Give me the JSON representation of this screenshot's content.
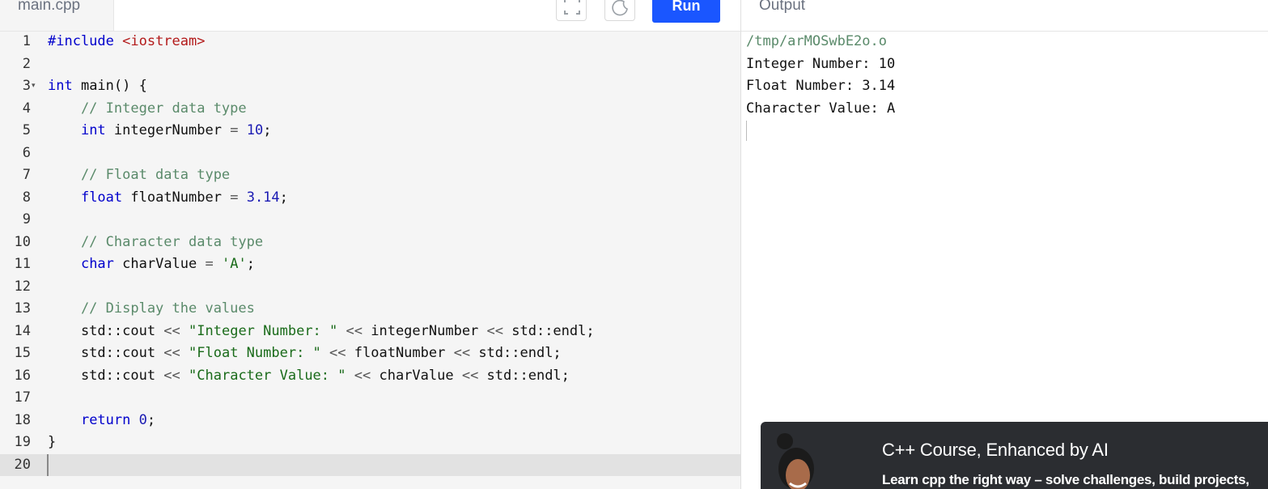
{
  "editor": {
    "file_tab": "main.cpp",
    "run_label": "Run",
    "fullscreen_icon": "fullscreen-icon",
    "theme_icon": "moon-icon",
    "lines": [
      {
        "n": "1",
        "tokens": [
          {
            "t": "#include ",
            "c": "kw"
          },
          {
            "t": "<iostream>",
            "c": "inc"
          }
        ]
      },
      {
        "n": "2",
        "tokens": []
      },
      {
        "n": "3",
        "fold": true,
        "tokens": [
          {
            "t": "int",
            "c": "kw"
          },
          {
            "t": " main() {",
            "c": ""
          }
        ]
      },
      {
        "n": "4",
        "tokens": [
          {
            "t": "    // Integer data type",
            "c": "cmt"
          }
        ]
      },
      {
        "n": "5",
        "tokens": [
          {
            "t": "    ",
            "c": ""
          },
          {
            "t": "int",
            "c": "kw"
          },
          {
            "t": " integerNumber ",
            "c": ""
          },
          {
            "t": "=",
            "c": "op"
          },
          {
            "t": " ",
            "c": ""
          },
          {
            "t": "10",
            "c": "num"
          },
          {
            "t": ";",
            "c": ""
          }
        ]
      },
      {
        "n": "6",
        "tokens": []
      },
      {
        "n": "7",
        "tokens": [
          {
            "t": "    // Float data type",
            "c": "cmt"
          }
        ]
      },
      {
        "n": "8",
        "tokens": [
          {
            "t": "    ",
            "c": ""
          },
          {
            "t": "float",
            "c": "kw"
          },
          {
            "t": " floatNumber ",
            "c": ""
          },
          {
            "t": "=",
            "c": "op"
          },
          {
            "t": " ",
            "c": ""
          },
          {
            "t": "3.14",
            "c": "num"
          },
          {
            "t": ";",
            "c": ""
          }
        ]
      },
      {
        "n": "9",
        "tokens": []
      },
      {
        "n": "10",
        "tokens": [
          {
            "t": "    // Character data type",
            "c": "cmt"
          }
        ]
      },
      {
        "n": "11",
        "tokens": [
          {
            "t": "    ",
            "c": ""
          },
          {
            "t": "char",
            "c": "kw"
          },
          {
            "t": " charValue ",
            "c": ""
          },
          {
            "t": "=",
            "c": "op"
          },
          {
            "t": " ",
            "c": ""
          },
          {
            "t": "'A'",
            "c": "chr"
          },
          {
            "t": ";",
            "c": ""
          }
        ]
      },
      {
        "n": "12",
        "tokens": []
      },
      {
        "n": "13",
        "tokens": [
          {
            "t": "    // Display the values",
            "c": "cmt"
          }
        ]
      },
      {
        "n": "14",
        "tokens": [
          {
            "t": "    std::cout ",
            "c": ""
          },
          {
            "t": "<<",
            "c": "op"
          },
          {
            "t": " ",
            "c": ""
          },
          {
            "t": "\"Integer Number: \"",
            "c": "str"
          },
          {
            "t": " ",
            "c": ""
          },
          {
            "t": "<<",
            "c": "op"
          },
          {
            "t": " integerNumber ",
            "c": ""
          },
          {
            "t": "<<",
            "c": "op"
          },
          {
            "t": " std::endl;",
            "c": ""
          }
        ]
      },
      {
        "n": "15",
        "tokens": [
          {
            "t": "    std::cout ",
            "c": ""
          },
          {
            "t": "<<",
            "c": "op"
          },
          {
            "t": " ",
            "c": ""
          },
          {
            "t": "\"Float Number: \"",
            "c": "str"
          },
          {
            "t": " ",
            "c": ""
          },
          {
            "t": "<<",
            "c": "op"
          },
          {
            "t": " floatNumber ",
            "c": ""
          },
          {
            "t": "<<",
            "c": "op"
          },
          {
            "t": " std::endl;",
            "c": ""
          }
        ]
      },
      {
        "n": "16",
        "tokens": [
          {
            "t": "    std::cout ",
            "c": ""
          },
          {
            "t": "<<",
            "c": "op"
          },
          {
            "t": " ",
            "c": ""
          },
          {
            "t": "\"Character Value: \"",
            "c": "str"
          },
          {
            "t": " ",
            "c": ""
          },
          {
            "t": "<<",
            "c": "op"
          },
          {
            "t": " charValue ",
            "c": ""
          },
          {
            "t": "<<",
            "c": "op"
          },
          {
            "t": " std::endl;",
            "c": ""
          }
        ]
      },
      {
        "n": "17",
        "tokens": []
      },
      {
        "n": "18",
        "tokens": [
          {
            "t": "    ",
            "c": ""
          },
          {
            "t": "return",
            "c": "kw"
          },
          {
            "t": " ",
            "c": ""
          },
          {
            "t": "0",
            "c": "num"
          },
          {
            "t": ";",
            "c": ""
          }
        ]
      },
      {
        "n": "19",
        "tokens": [
          {
            "t": "}",
            "c": ""
          }
        ]
      },
      {
        "n": "20",
        "active": true,
        "tokens": []
      }
    ]
  },
  "output": {
    "header": "Output",
    "lines": [
      "/tmp/arMOSwbE2o.o",
      "Integer Number: 10",
      "Float Number: 3.14",
      "Character Value: A"
    ]
  },
  "promo": {
    "title": "C++ Course, Enhanced by AI",
    "subtitle": "Learn cpp the right way – solve challenges, build projects,",
    "avatar_icon": "person-avatar"
  },
  "colors": {
    "run_button": "#1a56ff",
    "promo_bg": "#2b2d31"
  }
}
